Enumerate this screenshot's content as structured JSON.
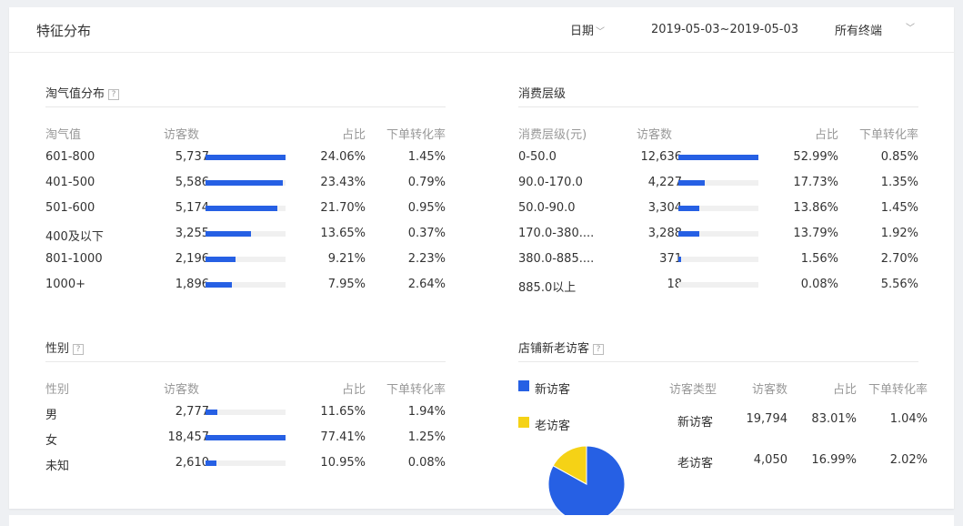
{
  "header": {
    "title": "特征分布",
    "date_label": "日期",
    "date_range": "2019-05-03~2019-05-03",
    "terminal": "所有终端"
  },
  "naughty": {
    "title": "淘气值分布",
    "help": "?",
    "headers": [
      "淘气值",
      "访客数",
      "占比",
      "下单转化率"
    ],
    "rows": [
      {
        "label": "601-800",
        "visitors": "5,737",
        "share": "24.06%",
        "conv": "1.45%",
        "fill": 1.0
      },
      {
        "label": "401-500",
        "visitors": "5,586",
        "share": "23.43%",
        "conv": "0.79%",
        "fill": 0.97
      },
      {
        "label": "501-600",
        "visitors": "5,174",
        "share": "21.70%",
        "conv": "0.95%",
        "fill": 0.9
      },
      {
        "label": "400及以下",
        "visitors": "3,255",
        "share": "13.65%",
        "conv": "0.37%",
        "fill": 0.57
      },
      {
        "label": "801-1000",
        "visitors": "2,196",
        "share": "9.21%",
        "conv": "2.23%",
        "fill": 0.38
      },
      {
        "label": "1000+",
        "visitors": "1,896",
        "share": "7.95%",
        "conv": "2.64%",
        "fill": 0.33
      }
    ]
  },
  "consumption": {
    "title": "消费层级",
    "headers": [
      "消费层级(元)",
      "访客数",
      "占比",
      "下单转化率"
    ],
    "rows": [
      {
        "label": "0-50.0",
        "visitors": "12,636",
        "share": "52.99%",
        "conv": "0.85%",
        "fill": 1.0
      },
      {
        "label": "90.0-170.0",
        "visitors": "4,227",
        "share": "17.73%",
        "conv": "1.35%",
        "fill": 0.33
      },
      {
        "label": "50.0-90.0",
        "visitors": "3,304",
        "share": "13.86%",
        "conv": "1.45%",
        "fill": 0.26
      },
      {
        "label": "170.0-380....",
        "visitors": "3,288",
        "share": "13.79%",
        "conv": "1.92%",
        "fill": 0.26
      },
      {
        "label": "380.0-885....",
        "visitors": "371",
        "share": "1.56%",
        "conv": "2.70%",
        "fill": 0.03
      },
      {
        "label": "885.0以上",
        "visitors": "18",
        "share": "0.08%",
        "conv": "5.56%",
        "fill": 0.0
      }
    ]
  },
  "gender": {
    "title": "性别",
    "help": "?",
    "headers": [
      "性别",
      "访客数",
      "占比",
      "下单转化率"
    ],
    "rows": [
      {
        "label": "男",
        "visitors": "2,777",
        "share": "11.65%",
        "conv": "1.94%",
        "fill": 0.15
      },
      {
        "label": "女",
        "visitors": "18,457",
        "share": "77.41%",
        "conv": "1.25%",
        "fill": 1.0
      },
      {
        "label": "未知",
        "visitors": "2,610",
        "share": "10.95%",
        "conv": "0.08%",
        "fill": 0.14
      }
    ]
  },
  "store_visitors": {
    "title": "店铺新老访客",
    "help": "?",
    "legend": [
      {
        "label": "新访客",
        "color": "#2660e4"
      },
      {
        "label": "老访客",
        "color": "#f5d216"
      }
    ],
    "headers": [
      "访客类型",
      "访客数",
      "占比",
      "下单转化率"
    ],
    "rows": [
      {
        "label": "新访客",
        "visitors": "19,794",
        "share": "83.01%",
        "conv": "1.04%"
      },
      {
        "label": "老访客",
        "visitors": "4,050",
        "share": "16.99%",
        "conv": "2.02%"
      }
    ],
    "pie": {
      "new_share": 83.01,
      "old_share": 16.99
    }
  },
  "colors": {
    "bar": "#2660e4",
    "track": "#f0f0f0",
    "new": "#2660e4",
    "old": "#f5d216"
  }
}
